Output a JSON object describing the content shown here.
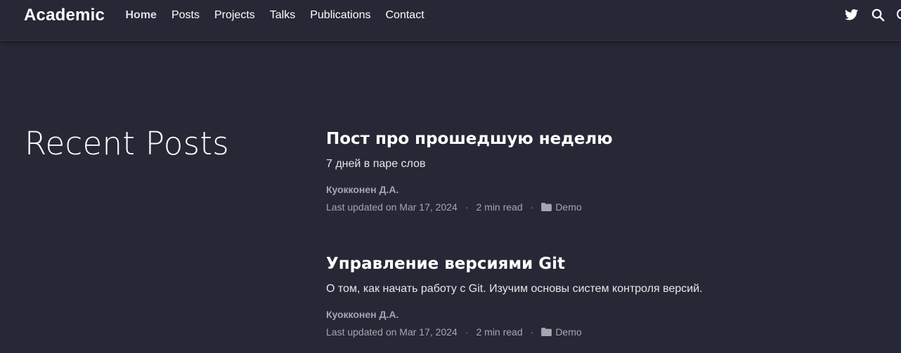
{
  "navbar": {
    "brand": "Academic",
    "links": [
      {
        "label": "Home"
      },
      {
        "label": "Posts"
      },
      {
        "label": "Projects"
      },
      {
        "label": "Talks"
      },
      {
        "label": "Publications"
      },
      {
        "label": "Contact"
      }
    ],
    "icons": [
      "twitter-icon",
      "search-icon",
      "theme-toggle-icon"
    ]
  },
  "section": {
    "title": "Recent Posts"
  },
  "posts": [
    {
      "title": "Пост про прошедшую неделю",
      "summary": "7 дней в паре слов",
      "author": "Куокконен Д.А.",
      "updated": "Last updated on Mar 17, 2024",
      "read_time": "2 min read",
      "category": "Demo",
      "separator": "·"
    },
    {
      "title": "Управление версиями Git",
      "summary": "О том, как начать работу с Git. Изучим основы систем контроля версий.",
      "author": "Куокконен Д.А.",
      "updated": "Last updated on Mar 17, 2024",
      "read_time": "2 min read",
      "category": "Demo",
      "separator": "·"
    }
  ],
  "colors": {
    "background": "#272835",
    "text": "#ffffff",
    "muted": "#a5a6b2"
  }
}
